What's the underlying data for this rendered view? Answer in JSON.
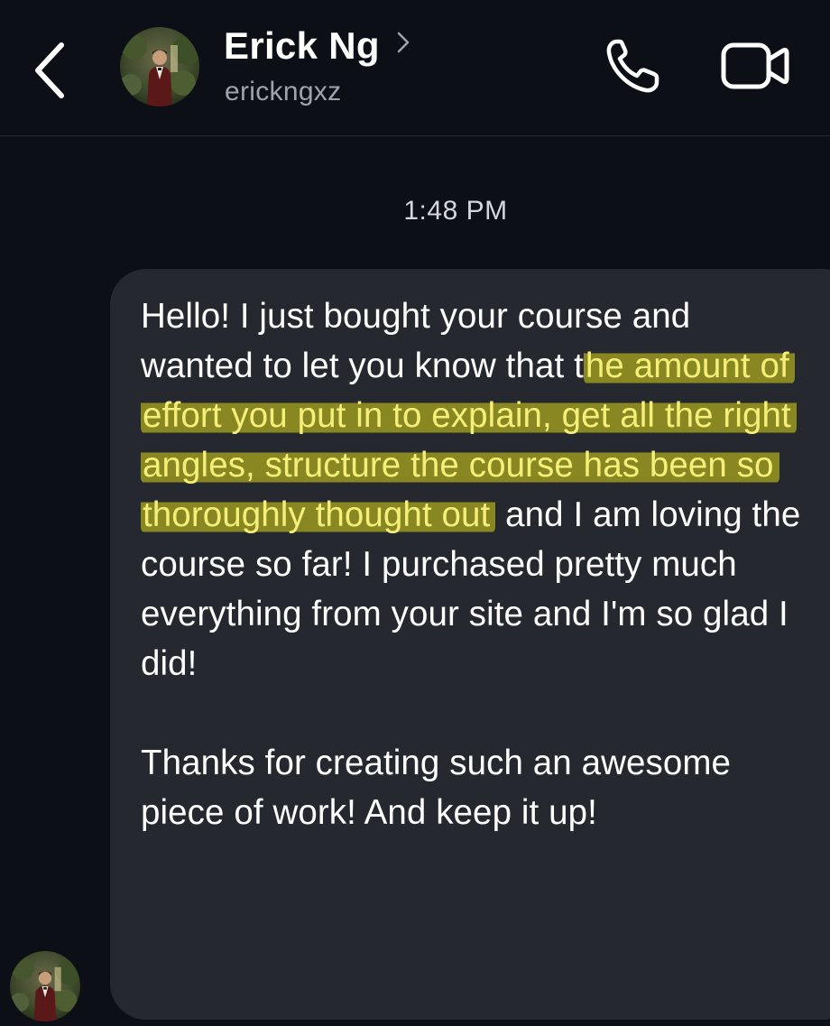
{
  "header": {
    "contact_name": "Erick Ng",
    "contact_handle": "erickngxz",
    "icons": {
      "back": "chevron-left-icon",
      "profile": "chevron-right-icon",
      "call": "phone-icon",
      "video": "video-camera-icon"
    }
  },
  "conversation": {
    "timestamp": "1:48 PM",
    "message": {
      "para1_before": "Hello! I just bought your course and wanted to let you know that t",
      "para1_highlight": "he amount of effort you put in to explain, get all the right angles, structure the course has been so thoroughly thought out",
      "para1_after": " and I am loving the course so far! I purchased pretty much everything from your site and I'm so glad I did!",
      "para2": "Thanks for creating such an awesome piece of work! And keep it up!"
    }
  },
  "colors": {
    "background": "#0d0f16",
    "bubble": "#262830",
    "highlight": "#9a9620",
    "highlight_text": "#f5ef7a",
    "handle_text": "#9ea3ad"
  }
}
